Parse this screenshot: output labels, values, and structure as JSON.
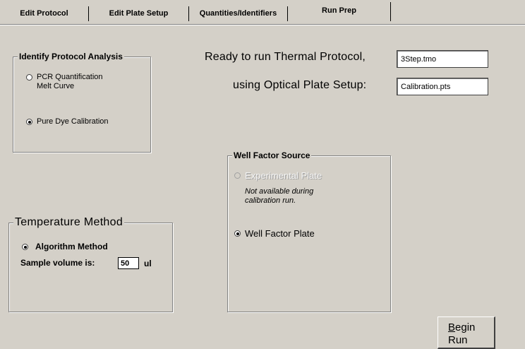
{
  "tabs": [
    {
      "label": "Edit Protocol",
      "active": false
    },
    {
      "label": "Edit Plate Setup",
      "active": false
    },
    {
      "label": "Quantities/Identifiers",
      "active": false
    },
    {
      "label": "Run Prep",
      "active": true
    }
  ],
  "identify_analysis": {
    "title": "Identify Protocol Analysis",
    "options": [
      {
        "label_line1": "PCR Quantification",
        "label_line2": "Melt Curve",
        "selected": false
      },
      {
        "label": "Pure Dye Calibration",
        "selected": true
      }
    ]
  },
  "ready": {
    "protocol_label": "Ready to run Thermal Protocol,",
    "protocol_value": "3Step.tmo",
    "plate_label": "using Optical Plate Setup:",
    "plate_value": "Calibration.pts"
  },
  "well_factor": {
    "title": "Well Factor Source",
    "experimental_label": "Experimental Plate",
    "experimental_note_line1": "Not available during",
    "experimental_note_line2": "calibration run.",
    "well_factor_label": "Well Factor Plate"
  },
  "temperature": {
    "title": "Temperature  Method",
    "algorithm_label": "Algorithm Method",
    "sample_volume_label": "Sample volume is:",
    "sample_volume_value": "50",
    "unit": "ul"
  },
  "begin_button": {
    "first_letter": "B",
    "rest_line1": "egin",
    "line2": "Run"
  }
}
